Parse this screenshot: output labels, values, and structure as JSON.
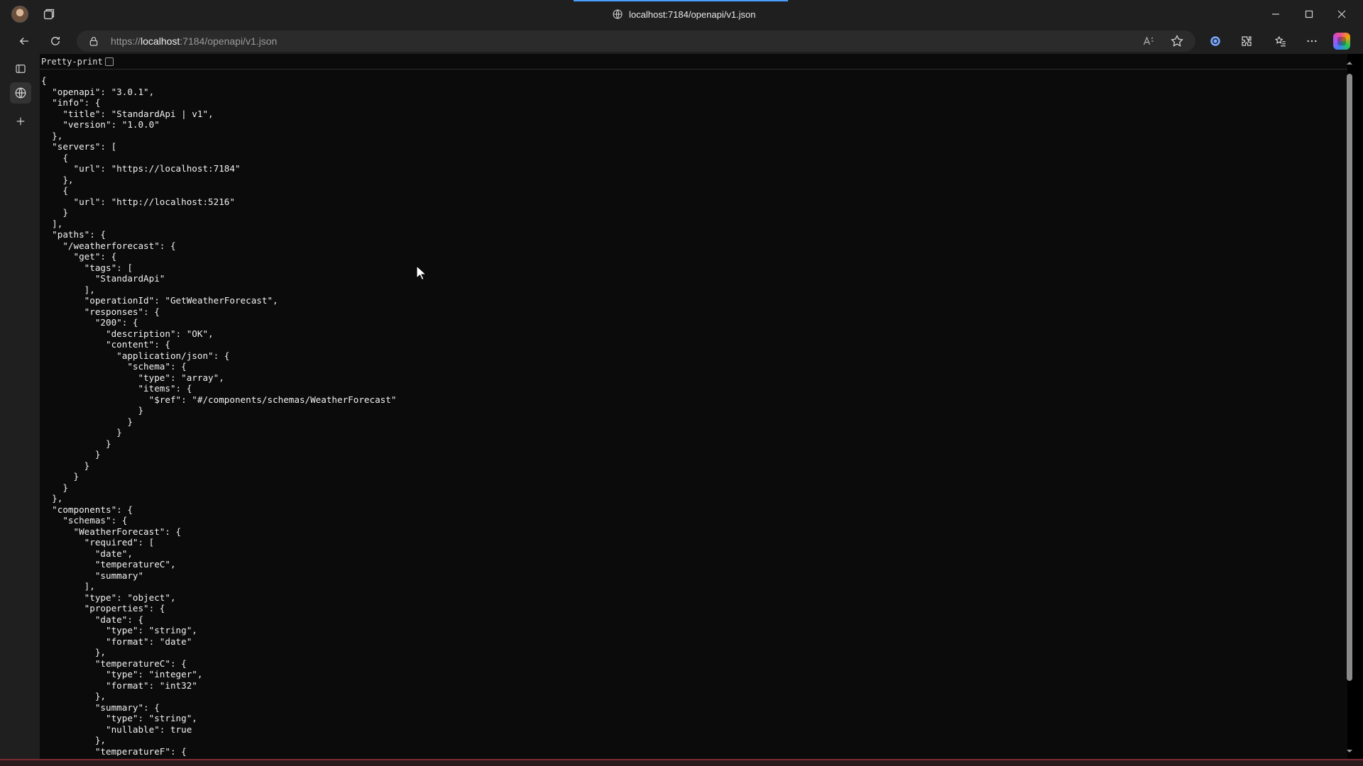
{
  "window": {
    "title": "localhost:7184/openapi/v1.json"
  },
  "toolbar": {
    "url_prefix": "https://",
    "url_host": "localhost",
    "url_rest": ":7184/openapi/v1.json"
  },
  "viewer": {
    "pretty_print_label": "Pretty-print",
    "pretty_print_checked": false,
    "lines": [
      "{",
      "  \"openapi\": \"3.0.1\",",
      "  \"info\": {",
      "    \"title\": \"StandardApi | v1\",",
      "    \"version\": \"1.0.0\"",
      "  },",
      "  \"servers\": [",
      "    {",
      "      \"url\": \"https://localhost:7184\"",
      "    },",
      "    {",
      "      \"url\": \"http://localhost:5216\"",
      "    }",
      "  ],",
      "  \"paths\": {",
      "    \"/weatherforecast\": {",
      "      \"get\": {",
      "        \"tags\": [",
      "          \"StandardApi\"",
      "        ],",
      "        \"operationId\": \"GetWeatherForecast\",",
      "        \"responses\": {",
      "          \"200\": {",
      "            \"description\": \"OK\",",
      "            \"content\": {",
      "              \"application/json\": {",
      "                \"schema\": {",
      "                  \"type\": \"array\",",
      "                  \"items\": {",
      "                    \"$ref\": \"#/components/schemas/WeatherForecast\"",
      "                  }",
      "                }",
      "              }",
      "            }",
      "          }",
      "        }",
      "      }",
      "    }",
      "  },",
      "  \"components\": {",
      "    \"schemas\": {",
      "      \"WeatherForecast\": {",
      "        \"required\": [",
      "          \"date\",",
      "          \"temperatureC\",",
      "          \"summary\"",
      "        ],",
      "        \"type\": \"object\",",
      "        \"properties\": {",
      "          \"date\": {",
      "            \"type\": \"string\",",
      "            \"format\": \"date\"",
      "          },",
      "          \"temperatureC\": {",
      "            \"type\": \"integer\",",
      "            \"format\": \"int32\"",
      "          },",
      "          \"summary\": {",
      "            \"type\": \"string\",",
      "            \"nullable\": true",
      "          },",
      "          \"temperatureF\": {"
    ]
  },
  "icons": {
    "tab_actions": "tab-actions-icon",
    "site_info": "globe-icon",
    "back": "back-arrow-icon",
    "refresh": "refresh-icon",
    "lock": "lock-icon",
    "read_aloud": "read-aloud-icon",
    "favorite": "star-icon",
    "extension": "extension-icon",
    "extensions": "puzzle-icon",
    "favorites": "favorites-icon",
    "more": "more-icon",
    "copilot": "copilot-icon"
  },
  "colors": {
    "accent": "#4a9eff",
    "chrome_bg": "#1f1f1f",
    "page_bg": "#0b0b0c"
  }
}
